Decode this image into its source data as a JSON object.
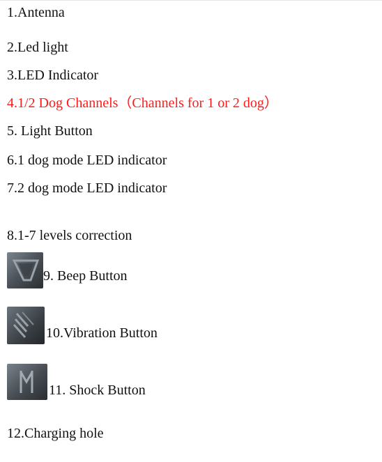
{
  "items": [
    {
      "text": "1.Antenna"
    },
    {
      "text": "2.Led light"
    },
    {
      "text": "3.LED Indicator"
    },
    {
      "text": "4.1/2 Dog Channels（Channels for 1 or 2 dog）"
    },
    {
      "text": "5. Light Button"
    },
    {
      "text": "6.1 dog mode LED indicator"
    },
    {
      "text": "7.2 dog mode LED indicator"
    },
    {
      "text": "8.1-7 levels correction"
    },
    {
      "text": "9. Beep Button",
      "icon": "beep-button-icon"
    },
    {
      "text": "10.Vibration Button",
      "icon": "vibration-button-icon"
    },
    {
      "text": "11. Shock Button",
      "icon": "shock-button-icon"
    },
    {
      "text": "12.Charging hole"
    }
  ],
  "colors": {
    "text": "#111111",
    "highlight": "#ff1a1a",
    "icon_dark": "#2b2f33",
    "icon_light": "#6f767d"
  }
}
